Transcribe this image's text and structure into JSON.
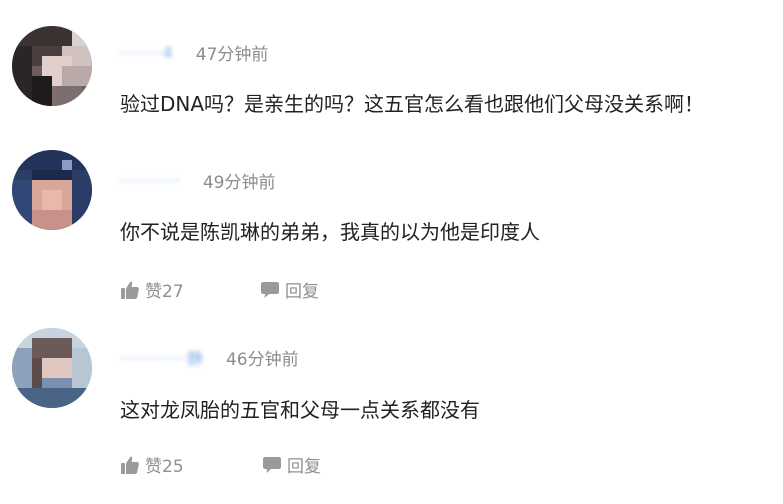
{
  "comments": [
    {
      "username": "·······4",
      "time": "47分钟前",
      "text": "验过DNA吗？是亲生的吗？这五官怎么看也跟他们父母没关系啊！"
    },
    {
      "username": "··········",
      "time": "49分钟前",
      "text": "你不说是陈凯琳的弟弟，我真的以为他是印度人",
      "likes_label": "赞27",
      "reply_label": "回复"
    },
    {
      "username": "···········静",
      "time": "46分钟前",
      "text": "这对龙凤胎的五官和父母一点关系都没有",
      "likes_label": "赞25",
      "reply_label": "回复"
    }
  ],
  "colors": {
    "username": "#4f8fe0",
    "meta": "#8c8c8c",
    "text": "#222222",
    "action": "#8f8f8f"
  }
}
